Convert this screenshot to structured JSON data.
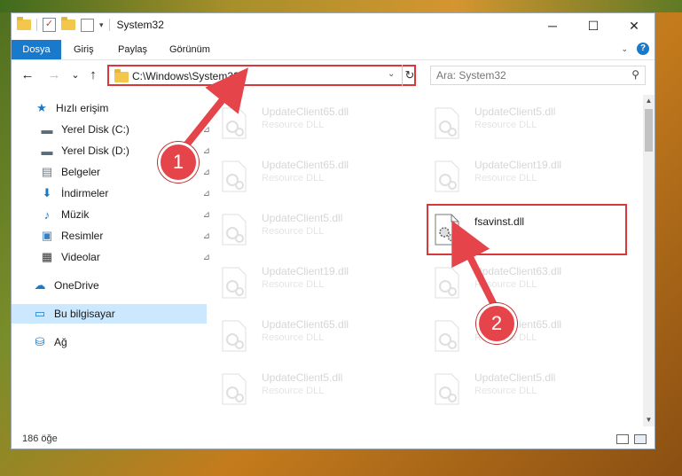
{
  "window": {
    "title": "System32",
    "controls": {
      "minimize": "─",
      "maximize": "☐",
      "close": "✕"
    }
  },
  "ribbon": {
    "tabs": [
      "Dosya",
      "Giriş",
      "Paylaş",
      "Görünüm"
    ],
    "collapse_icon": "chevron-down-icon",
    "help_icon": "?"
  },
  "navigation": {
    "back": "←",
    "forward": "→",
    "recent": "⌄",
    "up": "↑",
    "address": "C:\\Windows\\System32",
    "refresh": "↻",
    "search_placeholder": "Ara: System32"
  },
  "sidebar": {
    "items": [
      {
        "label": "Hızlı erişim",
        "icon": "star-icon",
        "glyph": "★",
        "pinned": false
      },
      {
        "label": "Yerel Disk (C:)",
        "icon": "drive-icon",
        "glyph": "▬",
        "pinned": true
      },
      {
        "label": "Yerel Disk (D:)",
        "icon": "drive-icon",
        "glyph": "▬",
        "pinned": true
      },
      {
        "label": "Belgeler",
        "icon": "documents-icon",
        "glyph": "▤",
        "pinned": true
      },
      {
        "label": "İndirmeler",
        "icon": "download-icon",
        "glyph": "⬇",
        "pinned": true
      },
      {
        "label": "Müzik",
        "icon": "music-icon",
        "glyph": "♪",
        "pinned": true
      },
      {
        "label": "Resimler",
        "icon": "pictures-icon",
        "glyph": "▣",
        "pinned": true
      },
      {
        "label": "Videolar",
        "icon": "video-icon",
        "glyph": "▦",
        "pinned": true
      },
      {
        "label": "OneDrive",
        "icon": "cloud-icon",
        "glyph": "☁",
        "pinned": false
      },
      {
        "label": "Bu bilgisayar",
        "icon": "computer-icon",
        "glyph": "▭",
        "pinned": false
      },
      {
        "label": "Ağ",
        "icon": "network-icon",
        "glyph": "⛁",
        "pinned": false
      }
    ],
    "pin_glyph": "📌"
  },
  "files": [
    {
      "name": "UpdateClient65.dll",
      "type": "Resource DLL",
      "faded": true
    },
    {
      "name": "UpdateClient5.dll",
      "type": "Resource DLL",
      "faded": true
    },
    {
      "name": "UpdateClient65.dll",
      "type": "Resource DLL",
      "faded": true
    },
    {
      "name": "UpdateClient19.dll",
      "type": "Resource DLL",
      "faded": true
    },
    {
      "name": "UpdateClient5.dll",
      "type": "Resource DLL",
      "faded": true
    },
    {
      "name": "fsavinst.dll",
      "type": "",
      "faded": false
    },
    {
      "name": "UpdateClient19.dll",
      "type": "Resource DLL",
      "faded": true
    },
    {
      "name": "UpdateClient63.dll",
      "type": "Resource DLL",
      "faded": true
    },
    {
      "name": "UpdateClient65.dll",
      "type": "Resource DLL",
      "faded": true
    },
    {
      "name": "UpdateClient65.dll",
      "type": "Resource DLL",
      "faded": true
    },
    {
      "name": "UpdateClient5.dll",
      "type": "Resource DLL",
      "faded": true
    },
    {
      "name": "UpdateClient5.dll",
      "type": "Resource DLL",
      "faded": true
    }
  ],
  "status": {
    "count": "186 öğe"
  },
  "annotations": [
    {
      "label": "1"
    },
    {
      "label": "2"
    }
  ],
  "colors": {
    "accent": "#1979ca",
    "highlight": "#d9383a",
    "selected": "#cce8ff"
  }
}
